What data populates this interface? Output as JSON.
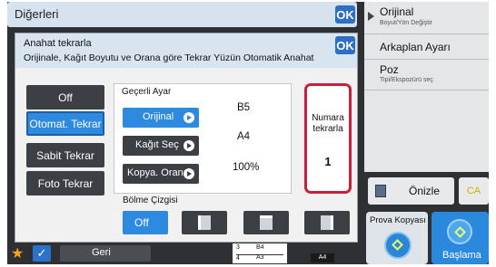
{
  "top_bar": {
    "title": "Diğerleri",
    "ok_label": "OK"
  },
  "right_menu": {
    "items": [
      {
        "label": "Orijinal",
        "sub": "Boyut/Yön Değiştir"
      },
      {
        "label": "Arkaplan Ayarı",
        "sub": ""
      },
      {
        "label": "Poz",
        "sub": "Tipi/Ekspozürü seç"
      }
    ]
  },
  "dialog": {
    "title": "Anahat tekrarla",
    "description": "Orijinale, Kağıt Boyutu ve Orana göre Tekrar Yüzün Otomatik Anahat",
    "ok_label": "OK",
    "modes": [
      "Off",
      "Otomat. Tekrar",
      "Sabit Tekrar",
      "Foto Tekrar"
    ],
    "active_mode": "Otomat. Tekrar",
    "gecerli": {
      "header": "Geçerli Ayar",
      "settings": [
        {
          "label": "Orijinal",
          "value": "B5"
        },
        {
          "label": "Kağıt Seç",
          "value": "A4"
        },
        {
          "label": "Kopya. Oranı",
          "value": "100%"
        }
      ]
    },
    "numara": {
      "label": "Numara tekrarla",
      "value": "1"
    },
    "bolme": {
      "label": "Bölme Çizgisi",
      "off_label": "Off"
    }
  },
  "preview": {
    "label": "Önizle"
  },
  "ca": {
    "label": "CA"
  },
  "prova": {
    "label": "Prova Kopyası"
  },
  "baslama": {
    "label": "Başlama"
  },
  "bottom_bar": {
    "back_label": "Geri",
    "paper_rows": [
      {
        "num": "3",
        "size": "B4"
      },
      {
        "num": "4",
        "size": "A3"
      }
    ],
    "current_paper": "A4"
  },
  "colors": {
    "accent": "#2e8ae0",
    "highlight": "#cc1e3a",
    "brand_start": "#2a89dc"
  }
}
